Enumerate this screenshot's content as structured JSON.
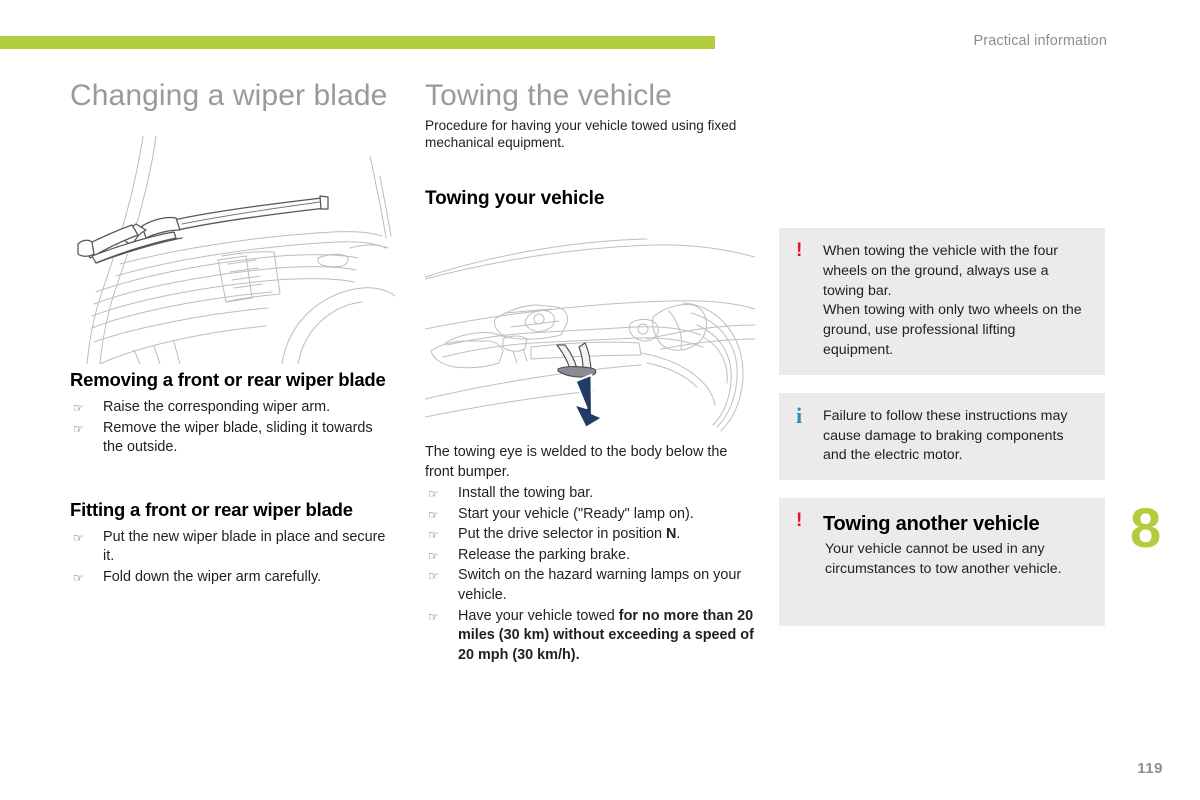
{
  "header": {
    "section": "Practical information",
    "accent_color": "#b2ce3c"
  },
  "chapter": {
    "tab_number": "8",
    "page_number": "119"
  },
  "left_column": {
    "title": "Changing a wiper blade",
    "figure_caption": "wiper-arm-raised-on-windscreen-line-drawing",
    "sections": [
      {
        "heading": "Removing a front or rear wiper blade",
        "steps": [
          "Raise the corresponding wiper arm.",
          "Remove the wiper blade, sliding it towards the outside."
        ]
      },
      {
        "heading": "Fitting a front or rear wiper blade",
        "steps": [
          "Put the new wiper blade in place and secure it.",
          "Fold down the wiper arm carefully."
        ]
      }
    ]
  },
  "middle_column": {
    "title": "Towing the vehicle",
    "intro": "Procedure for having your vehicle towed using fixed mechanical equipment.",
    "sub_heading": "Towing your vehicle",
    "figure_caption": "vehicle-underbody-towing-eye-with-arrow-line-drawing",
    "paragraph": "The towing eye is welded to the body below the front bumper.",
    "steps": [
      {
        "text": "Install the towing bar.",
        "bold_tail": ""
      },
      {
        "text": "Start your vehicle (\"Ready\" lamp on).",
        "bold_tail": ""
      },
      {
        "text": "Put the drive selector in position ",
        "bold_tail": "N",
        "suffix": "."
      },
      {
        "text": "Release the parking brake.",
        "bold_tail": ""
      },
      {
        "text": "Switch on the hazard warning lamps on your vehicle.",
        "bold_tail": ""
      },
      {
        "text": "Have your vehicle towed ",
        "bold_tail": "for no more than 20 miles (30 km) without exceeding a speed of 20 mph (30 km/h)",
        "suffix": "."
      }
    ]
  },
  "right_column": {
    "notices": [
      {
        "id": "towing-warning",
        "icon": "warning-exclamation-icon",
        "icon_glyph": "!",
        "icon_color": "#e0162b",
        "heading": "",
        "body": "When towing the vehicle with the four wheels on the ground, always use a towing bar.\nWhen towing with only two wheels on the ground, use professional lifting equipment."
      },
      {
        "id": "braking-info",
        "icon": "information-icon",
        "icon_glyph": "i",
        "icon_color": "#2b8fae",
        "heading": "",
        "body": "Failure to follow these instructions may cause damage to braking components and the electric motor."
      },
      {
        "id": "tow-another-vehicle",
        "icon": "warning-exclamation-icon",
        "icon_glyph": "!",
        "icon_color": "#e0162b",
        "heading": "Towing another vehicle",
        "body": "Your vehicle cannot be used in any circumstances to tow another vehicle."
      }
    ]
  }
}
